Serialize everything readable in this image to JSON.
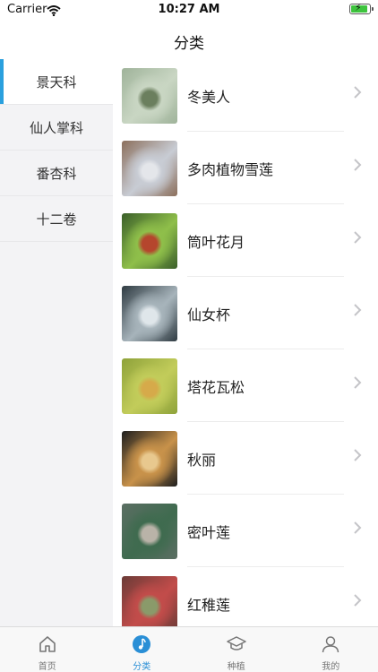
{
  "status_bar": {
    "carrier": "Carrier",
    "time": "10:27 AM"
  },
  "nav": {
    "title": "分类"
  },
  "sidebar": {
    "items": [
      {
        "label": "景天科",
        "active": true
      },
      {
        "label": "仙人掌科",
        "active": false
      },
      {
        "label": "番杏科",
        "active": false
      },
      {
        "label": "十二卷",
        "active": false
      }
    ]
  },
  "plants": [
    {
      "name": "冬美人",
      "thumb_colors": [
        "#9fb39a",
        "#c9d6c3",
        "#6b7f5e"
      ]
    },
    {
      "name": "多肉植物雪莲",
      "thumb_colors": [
        "#8b6f5c",
        "#c8ccd4",
        "#e4e6ea"
      ]
    },
    {
      "name": "筒叶花月",
      "thumb_colors": [
        "#3b5f2a",
        "#8fbf4a",
        "#b5462d"
      ]
    },
    {
      "name": "仙女杯",
      "thumb_colors": [
        "#2f3b42",
        "#a7b4bb",
        "#dfe6ea"
      ]
    },
    {
      "name": "塔花瓦松",
      "thumb_colors": [
        "#8ea23a",
        "#c2cc5a",
        "#d6aa4a"
      ]
    },
    {
      "name": "秋丽",
      "thumb_colors": [
        "#1e1e1e",
        "#c8924a",
        "#e8c88e"
      ]
    },
    {
      "name": "密叶莲",
      "thumb_colors": [
        "#5b6e63",
        "#3f6b4f",
        "#b9b3a8"
      ]
    },
    {
      "name": "红稚莲",
      "thumb_colors": [
        "#6b3b37",
        "#c24c4a",
        "#8a9a6a"
      ]
    }
  ],
  "tabs": [
    {
      "label": "首页",
      "icon": "home-icon",
      "active": false
    },
    {
      "label": "分类",
      "icon": "music-note-icon",
      "active": true
    },
    {
      "label": "种植",
      "icon": "graduation-cap-icon",
      "active": false
    },
    {
      "label": "我的",
      "icon": "user-icon",
      "active": false
    }
  ],
  "colors": {
    "accent": "#2a8fd6",
    "sidebar_bg": "#f3f3f5",
    "battery": "#3ec43e"
  }
}
